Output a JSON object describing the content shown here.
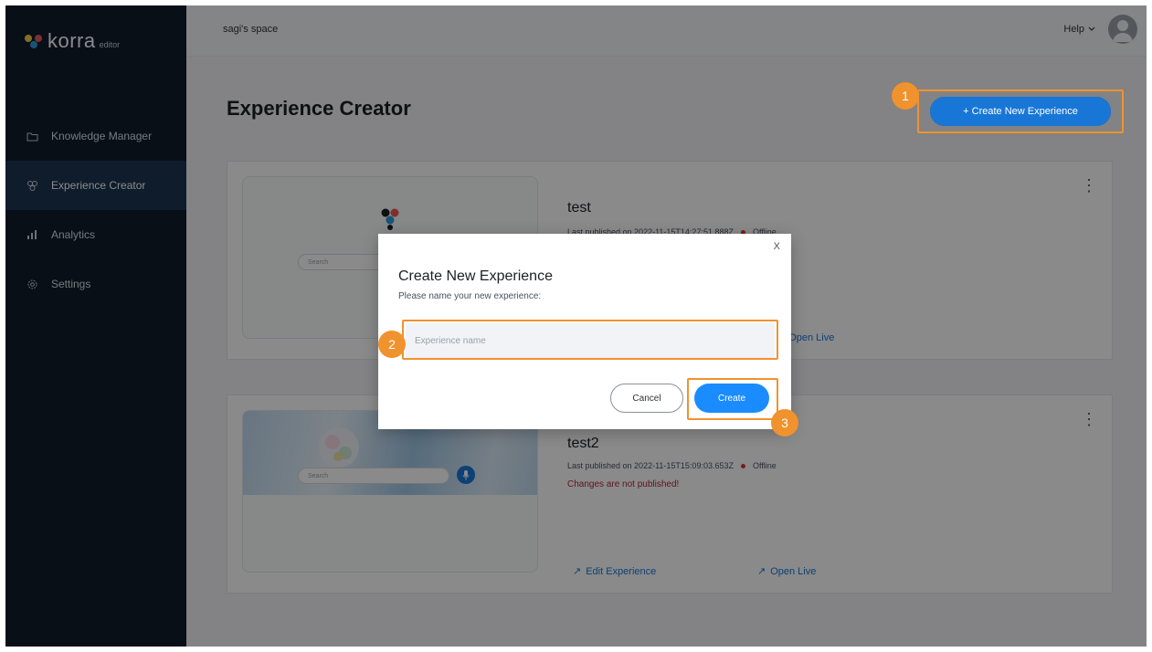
{
  "app": {
    "logo_word": "korra",
    "logo_sub": "editor"
  },
  "sidebar": {
    "items": [
      {
        "label": "Knowledge Manager",
        "icon": "folder-icon"
      },
      {
        "label": "Experience Creator",
        "icon": "experience-icon",
        "active": true
      },
      {
        "label": "Analytics",
        "icon": "bar-chart-icon"
      },
      {
        "label": "Settings",
        "icon": "gear-icon"
      }
    ]
  },
  "header": {
    "space_name": "sagi's space",
    "help_label": "Help"
  },
  "main": {
    "title": "Experience Creator",
    "create_button_label": "+ Create New Experience",
    "step_badges": [
      "1",
      "2",
      "3"
    ],
    "search_placeholder": "Search",
    "cards": [
      {
        "name": "test",
        "meta": "Last published on 2022-11-15T14:27:51.888Z",
        "status": "Offline",
        "open_live": "Open Live"
      },
      {
        "name": "test2",
        "meta": "Last published on 2022-11-15T15:09:03.653Z",
        "status": "Offline",
        "warning": "Changes are not published!",
        "edit_label": "Edit Experience",
        "open_live": "Open Live"
      }
    ]
  },
  "dialog": {
    "close": "X",
    "title": "Create New Experience",
    "subtitle": "Please name your new experience:",
    "input_placeholder": "Experience name",
    "cancel_label": "Cancel",
    "create_label": "Create"
  },
  "colors": {
    "sidebar_bg": "#0f1d2c",
    "accent": "#1877d6",
    "highlight": "#f0922e",
    "offline": "#d9363e"
  }
}
